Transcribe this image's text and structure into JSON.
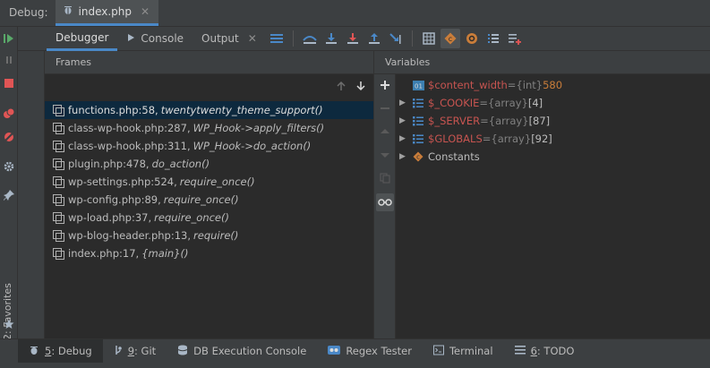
{
  "titlebar": {
    "label": "Debug:",
    "tab": "index.php",
    "tab_close": "✕"
  },
  "tabs": [
    {
      "label": "Debugger"
    },
    {
      "label": "Console"
    },
    {
      "label": "Output"
    }
  ],
  "tab_close": "✕",
  "frames": {
    "header": "Frames",
    "rows": [
      {
        "file": "functions.php:58,",
        "fn": "twentytwenty_theme_support()"
      },
      {
        "file": "class-wp-hook.php:287,",
        "fn": "WP_Hook->apply_filters()"
      },
      {
        "file": "class-wp-hook.php:311,",
        "fn": "WP_Hook->do_action()"
      },
      {
        "file": "plugin.php:478,",
        "fn": "do_action()"
      },
      {
        "file": "wp-settings.php:524,",
        "fn": "require_once()"
      },
      {
        "file": "wp-config.php:89,",
        "fn": "require_once()"
      },
      {
        "file": "wp-load.php:37,",
        "fn": "require_once()"
      },
      {
        "file": "wp-blog-header.php:13,",
        "fn": "require()"
      },
      {
        "file": "index.php:17,",
        "fn": "{main}()"
      }
    ]
  },
  "variables": {
    "header": "Variables",
    "rows": [
      {
        "name": "$content_width",
        "eq": " = ",
        "type": "{int}",
        "value": " 580"
      },
      {
        "name": "$_COOKIE",
        "eq": " = ",
        "type": "{array}",
        "value": " [4]"
      },
      {
        "name": "$_SERVER",
        "eq": " = ",
        "type": "{array}",
        "value": " [87]"
      },
      {
        "name": "$GLOBALS",
        "eq": " = ",
        "type": "{array}",
        "value": " [92]"
      },
      {
        "plain": "Constants"
      }
    ]
  },
  "bottom": [
    {
      "num": "5",
      "label": ": Debug"
    },
    {
      "num": "9",
      "label": ": Git"
    },
    {
      "label": "DB Execution Console"
    },
    {
      "label": "Regex Tester"
    },
    {
      "label": "Terminal"
    },
    {
      "num": "6",
      "label": ": TODO"
    }
  ],
  "favorites": "2: Favorites",
  "colors": {
    "accent": "#4a88c7",
    "selection": "#0d293e",
    "var_name": "#c75450",
    "value": "#c97d3a",
    "green": "#59a869",
    "red": "#e05555"
  }
}
